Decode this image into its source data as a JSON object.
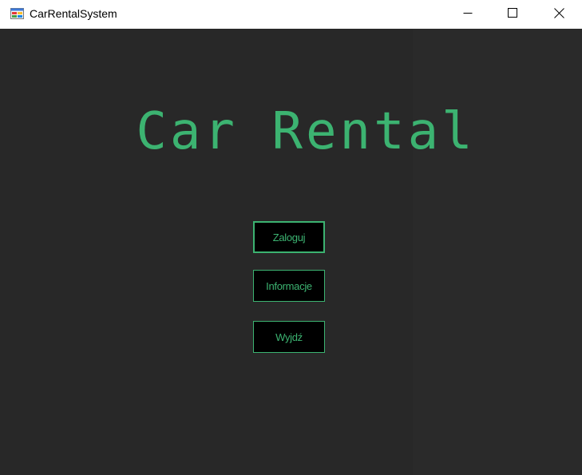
{
  "window": {
    "title": "CarRentalSystem",
    "icon": "winforms-app-icon",
    "controls": {
      "minimize_icon": "minimize-icon",
      "maximize_icon": "maximize-icon",
      "close_icon": "close-icon"
    }
  },
  "main": {
    "heading": "Car Rental",
    "buttons": {
      "login_label": "Zaloguj",
      "info_label": "Informacje",
      "exit_label": "Wyjdź"
    }
  },
  "colors": {
    "background": "#282828",
    "accent": "#3cb371",
    "button_bg": "#000000"
  }
}
